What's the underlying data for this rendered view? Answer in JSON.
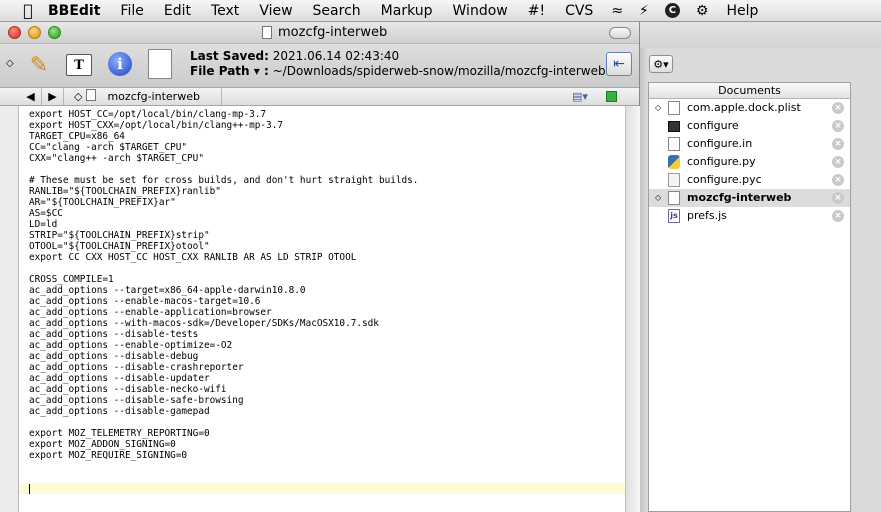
{
  "menubar": {
    "app_name": "BBEdit",
    "items": [
      "File",
      "Edit",
      "Text",
      "View",
      "Search",
      "Markup",
      "Window",
      "#!",
      "CVS"
    ],
    "help": "Help"
  },
  "window": {
    "title": "mozcfg-interweb"
  },
  "toolbar": {
    "last_saved_label": "Last Saved:",
    "last_saved_value": "2021.06.14 02:43:40",
    "file_path_label": "File Path ▾ :",
    "file_path_value": "~/Downloads/spiderweb-snow/mozilla/mozcfg-interweb",
    "text_button_label": "T"
  },
  "navbar": {
    "prev": "◀",
    "next": "▶",
    "document_name": "mozcfg-interweb"
  },
  "editor": {
    "code": "export HOST_CC=/opt/local/bin/clang-mp-3.7\nexport HOST_CXX=/opt/local/bin/clang++-mp-3.7\nTARGET_CPU=x86_64\nCC=\"clang -arch $TARGET_CPU\"\nCXX=\"clang++ -arch $TARGET_CPU\"\n\n# These must be set for cross builds, and don't hurt straight builds.\nRANLIB=\"${TOOLCHAIN_PREFIX}ranlib\"\nAR=\"${TOOLCHAIN_PREFIX}ar\"\nAS=$CC\nLD=ld\nSTRIP=\"${TOOLCHAIN_PREFIX}strip\"\nOTOOL=\"${TOOLCHAIN_PREFIX}otool\"\nexport CC CXX HOST_CC HOST_CXX RANLIB AR AS LD STRIP OTOOL\n\nCROSS_COMPILE=1\nac_add_options --target=x86_64-apple-darwin10.8.0\nac_add_options --enable-macos-target=10.6\nac_add_options --enable-application=browser\nac_add_options --with-macos-sdk=/Developer/SDKs/MacOSX10.7.sdk\nac_add_options --disable-tests\nac_add_options --enable-optimize=-O2\nac_add_options --disable-debug\nac_add_options --disable-crashreporter\nac_add_options --disable-updater\nac_add_options --disable-necko-wifi\nac_add_options --disable-safe-browsing\nac_add_options --disable-gamepad\n\nexport MOZ_TELEMETRY_REPORTING=0\nexport MOZ_ADDON_SIGNING=0\nexport MOZ_REQUIRE_SIGNING=0"
  },
  "drawer": {
    "header": "Documents",
    "documents": [
      {
        "name": "com.apple.dock.plist",
        "icon": "document-icon",
        "marked": true,
        "active": false
      },
      {
        "name": "configure",
        "icon": "terminal-icon",
        "marked": false,
        "active": false
      },
      {
        "name": "configure.in",
        "icon": "document-icon",
        "marked": false,
        "active": false
      },
      {
        "name": "configure.py",
        "icon": "python-icon",
        "marked": false,
        "active": false
      },
      {
        "name": "configure.pyc",
        "icon": "pyc-icon",
        "marked": false,
        "active": false
      },
      {
        "name": "mozcfg-interweb",
        "icon": "document-icon",
        "marked": true,
        "active": true
      },
      {
        "name": "prefs.js",
        "icon": "js-icon",
        "marked": false,
        "active": false
      }
    ]
  }
}
